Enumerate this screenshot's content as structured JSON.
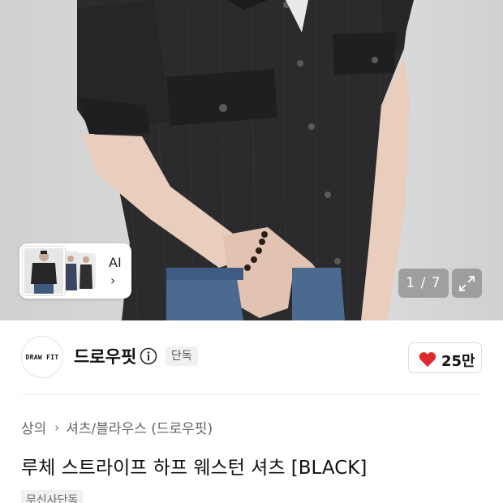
{
  "gallery": {
    "counter": "1 / 7",
    "ai_label": "AI",
    "ai_chevron": "›",
    "icons": {
      "expand": "expand-arrows-icon",
      "chevron": "chevron-right-icon"
    }
  },
  "brand": {
    "logo_text": "DRAW FIT",
    "name": "드로우핏",
    "badge": "단독",
    "likes": "25만",
    "colors": {
      "heart": "#e0282e"
    }
  },
  "product": {
    "breadcrumb": [
      "상의",
      "셔츠/블라우스 (드로우핏)"
    ],
    "breadcrumb_separator": "›",
    "title": "루체 스트라이프 하프 웨스턴 셔츠 [BLACK]",
    "promo_tag": "무신사단독"
  }
}
